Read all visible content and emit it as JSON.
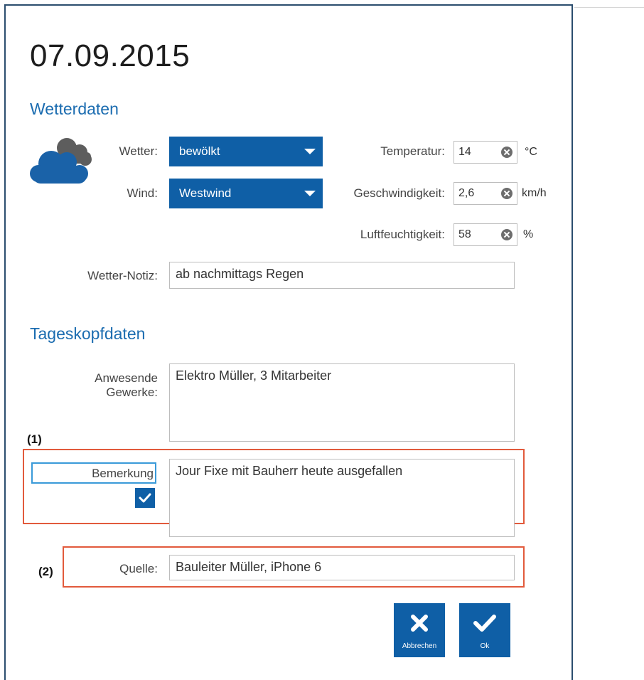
{
  "date": "07.09.2015",
  "weather_section": {
    "title": "Wetterdaten",
    "weather_label": "Wetter:",
    "weather_value": "bewölkt",
    "wind_label": "Wind:",
    "wind_value": "Westwind",
    "temperature_label": "Temperatur:",
    "temperature_value": "14",
    "temperature_unit": "°C",
    "speed_label": "Geschwindigkeit:",
    "speed_value": "2,6",
    "speed_unit": "km/h",
    "humidity_label": "Luftfeuchtigkeit:",
    "humidity_value": "58",
    "humidity_unit": "%",
    "note_label": "Wetter-Notiz:",
    "note_value": "ab nachmittags Regen",
    "icon": "cloudy-weather-icon"
  },
  "day_section": {
    "title": "Tageskopfdaten",
    "trades_label_line1": "Anwesende",
    "trades_label_line2": "Gewerke:",
    "trades_value": "Elektro Müller, 3 Mitarbeiter",
    "remark_label": "Bemerkung",
    "remark_checked": true,
    "remark_value": "Jour Fixe mit Bauherr heute ausgefallen",
    "source_label": "Quelle:",
    "source_value": "Bauleiter Müller, iPhone 6"
  },
  "annotations": {
    "one": "(1)",
    "two": "(2)"
  },
  "buttons": {
    "cancel": "Abbrechen",
    "ok": "Ok"
  },
  "colors": {
    "accent": "#0f5fa6",
    "section_title": "#1b6cb0",
    "highlight": "#e25a3c",
    "dialog_border": "#2b4d6e"
  }
}
